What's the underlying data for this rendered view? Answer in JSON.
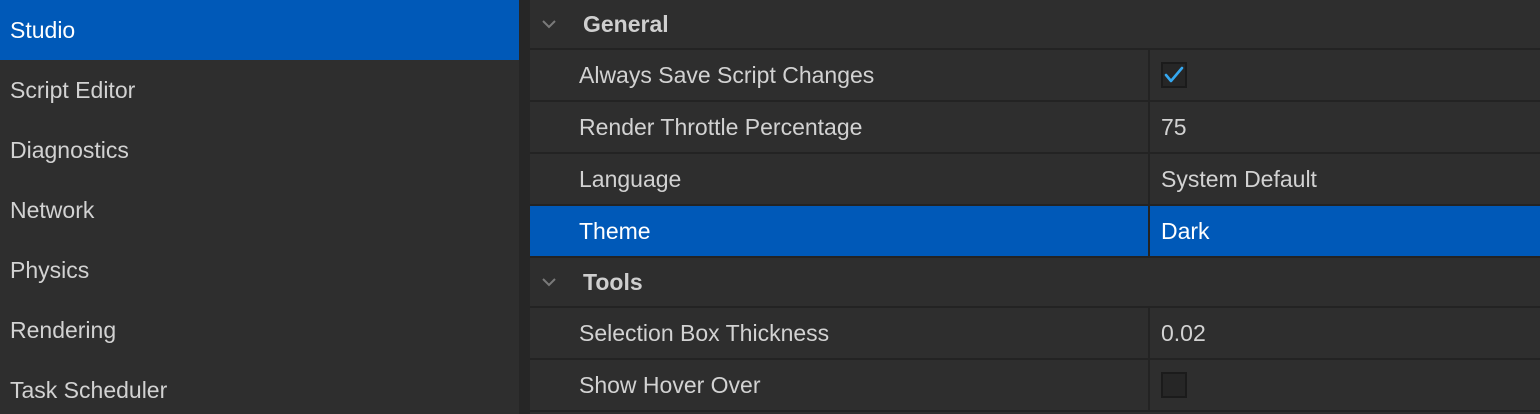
{
  "sidebar": {
    "items": [
      {
        "label": "Studio",
        "active": true
      },
      {
        "label": "Script Editor"
      },
      {
        "label": "Diagnostics"
      },
      {
        "label": "Network"
      },
      {
        "label": "Physics"
      },
      {
        "label": "Rendering"
      },
      {
        "label": "Task Scheduler"
      }
    ]
  },
  "sections": {
    "general": {
      "title": "General",
      "rows": {
        "always_save": {
          "name": "Always Save Script Changes",
          "checked": true
        },
        "render_throttle": {
          "name": "Render Throttle Percentage",
          "value": "75"
        },
        "language": {
          "name": "Language",
          "value": "System Default"
        },
        "theme": {
          "name": "Theme",
          "value": "Dark"
        }
      }
    },
    "tools": {
      "title": "Tools",
      "rows": {
        "selection_box": {
          "name": "Selection Box Thickness",
          "value": "0.02"
        },
        "show_hover": {
          "name": "Show Hover Over",
          "checked": false
        }
      }
    }
  },
  "colors": {
    "accent": "#0059b8",
    "check": "#35a8f0",
    "background": "#2e2e2e",
    "divider": "#232323"
  }
}
